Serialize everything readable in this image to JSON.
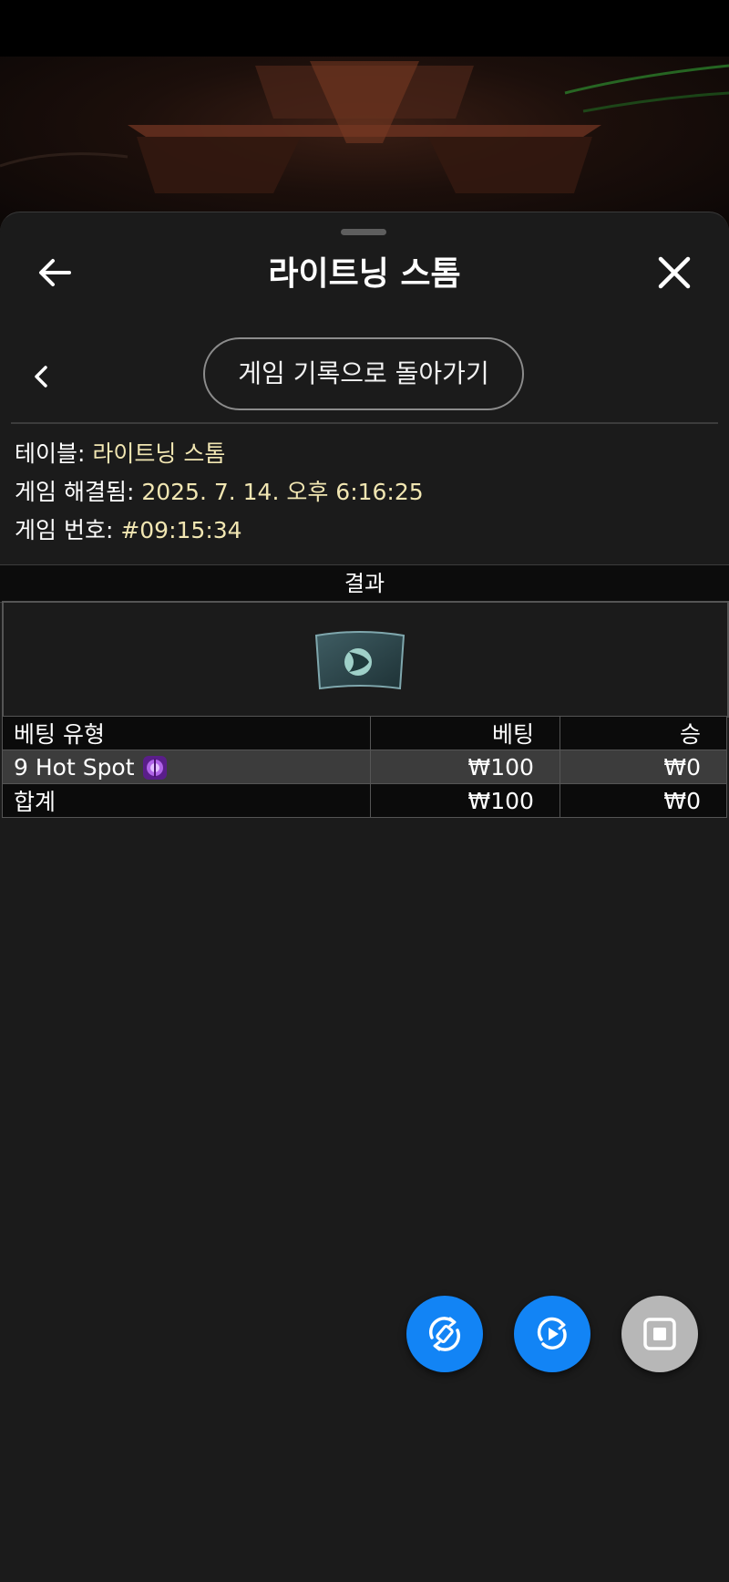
{
  "header": {
    "title": "라이트닝 스톰",
    "back_icon": "arrow-left-icon",
    "close_icon": "close-icon"
  },
  "nav": {
    "back_to_history_label": "게임 기록으로 돌아가기",
    "chevron_icon": "chevron-left-icon"
  },
  "info": {
    "table_label": "테이블:",
    "table_value": "라이트닝 스톰",
    "resolved_label": "게임 해결됨:",
    "resolved_value": "2025. 7. 14. 오후 6:16:25",
    "round_label": "게임 번호:",
    "round_value": "#09:15:34"
  },
  "result": {
    "header": "결과",
    "card_icon": "lightning-result-card-icon"
  },
  "bets_table": {
    "columns": [
      "베팅 유형",
      "베팅",
      "승"
    ],
    "rows": [
      {
        "type": "9 Hot Spot",
        "bet": "₩100",
        "win": "₩0",
        "icon": "hot-spot-icon"
      }
    ],
    "total": {
      "label": "합계",
      "bet": "₩100",
      "win": "₩0"
    }
  },
  "controls": {
    "buttons": [
      "rotate-icon",
      "replay-icon",
      "stop-icon"
    ]
  },
  "colors": {
    "accent_value": "#f1e6b2",
    "fab_blue": "#1284f5",
    "fab_gray": "#b7b7b7",
    "sheet_bg": "#1b1b1b"
  }
}
